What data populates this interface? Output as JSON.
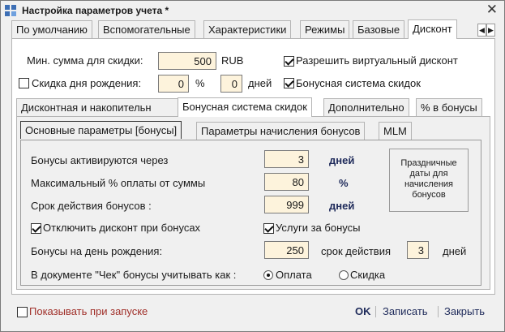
{
  "window": {
    "title": "Настройка параметров учета *",
    "close_glyph": "✕"
  },
  "top_tabs": [
    "По умолчанию",
    "Вспомогательные",
    "Характеристики",
    "Режимы",
    "Базовые",
    "Дисконт"
  ],
  "tab_scroll": {
    "left": "◀",
    "right": "▶"
  },
  "discount": {
    "min_sum_label": "Мин. сумма для скидки:",
    "min_sum_value": "500",
    "currency": "RUB",
    "allow_virtual_label": "Разрешить виртуальный дисконт",
    "allow_virtual_checked": true,
    "birthday_label": "Скидка дня рождения:",
    "birthday_checked": false,
    "birthday_percent": "0",
    "percent_sign": "%",
    "birthday_days": "0",
    "days_label": "дней",
    "bonus_system_label": "Бонусная система скидок",
    "bonus_system_checked": true
  },
  "sub_tabs": [
    "Дисконтная и накопительн",
    "Бонусная система скидок",
    "Дополнительно",
    "% в бонусы"
  ],
  "inner_tabs": [
    "Основные параметры [бонусы]",
    "Параметры начисления бонусов",
    "MLM"
  ],
  "bonus": {
    "activate_label": "Бонусы активируются через",
    "activate_value": "3",
    "activate_unit": "дней",
    "max_pct_label": "Максимальный % оплаты от суммы",
    "max_pct_value": "80",
    "max_pct_unit": "%",
    "validity_label": "Срок действия бонусов :",
    "validity_value": "999",
    "validity_unit": "дней",
    "holiday_button": "Праздничные даты для начисления бонусов",
    "disable_discount_label": "Отключить дисконт при бонусах",
    "disable_discount_checked": true,
    "services_label": "Услуги за бонусы",
    "services_checked": true,
    "birthday_bonus_label": "Бонусы на день рождения:",
    "birthday_bonus_value": "250",
    "birthday_validity_label": "срок действия",
    "birthday_validity_value": "3",
    "birthday_validity_unit": "дней",
    "receipt_label": "В документе \"Чек\" бонусы учитывать как :",
    "receipt_options": [
      "Оплата",
      "Скидка"
    ],
    "receipt_selected": "Оплата"
  },
  "footer": {
    "show_on_start_label": "Показывать при запуске",
    "show_on_start_checked": false,
    "ok": "OK",
    "save": "Записать",
    "close": "Закрыть"
  },
  "colors": {
    "input_bg": "#fdf3dc",
    "footer_label": "#a0302a",
    "unit_bold": "#1e2a5a"
  }
}
